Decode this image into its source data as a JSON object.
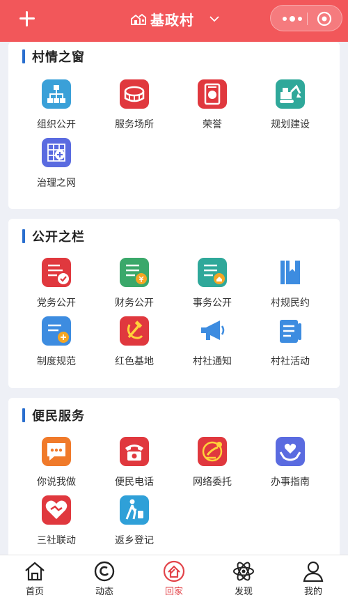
{
  "header": {
    "title": "基政村",
    "left_icon": "plus-icon",
    "title_icon": "village-icon",
    "dropdown_icon": "chevron-down-icon",
    "more_icon": "more-dots-icon",
    "close_icon": "target-icon",
    "bg_color": "#f2575a"
  },
  "sections": [
    {
      "title": "村情之窗",
      "items": [
        {
          "label": "组织公开",
          "icon": "org-chart-icon",
          "color": "#3aa0d8"
        },
        {
          "label": "服务场所",
          "icon": "stadium-icon",
          "color": "#e0383e"
        },
        {
          "label": "荣誉",
          "icon": "medal-icon",
          "color": "#e0383e"
        },
        {
          "label": "规划建设",
          "icon": "excavator-icon",
          "color": "#2fa89a"
        },
        {
          "label": "治理之网",
          "icon": "grid-shield-icon",
          "color": "#5a6be0"
        }
      ]
    },
    {
      "title": "公开之栏",
      "items": [
        {
          "label": "党务公开",
          "icon": "party-doc-icon",
          "color": "#e0383e"
        },
        {
          "label": "财务公开",
          "icon": "finance-doc-icon",
          "color": "#3aa86a"
        },
        {
          "label": "事务公开",
          "icon": "affairs-doc-icon",
          "color": "#2fa89a"
        },
        {
          "label": "村规民约",
          "icon": "bookmark-book-icon",
          "color": "#3d8ce0"
        },
        {
          "label": "制度规范",
          "icon": "rules-doc-icon",
          "color": "#3d8ce0"
        },
        {
          "label": "红色基地",
          "icon": "hammer-sickle-icon",
          "color": "#e0383e"
        },
        {
          "label": "村社通知",
          "icon": "megaphone-icon",
          "color": "#3d8ce0"
        },
        {
          "label": "村社活动",
          "icon": "activity-doc-icon",
          "color": "#3d8ce0"
        }
      ]
    },
    {
      "title": "便民服务",
      "items": [
        {
          "label": "你说我做",
          "icon": "chat-bubble-icon",
          "color": "#f07a2a"
        },
        {
          "label": "便民电话",
          "icon": "telephone-icon",
          "color": "#e0383e"
        },
        {
          "label": "网络委托",
          "icon": "delegate-icon",
          "color": "#e0383e"
        },
        {
          "label": "办事指南",
          "icon": "heart-hand-icon",
          "color": "#5a6be0"
        },
        {
          "label": "三社联动",
          "icon": "handshake-heart-icon",
          "color": "#e0383e"
        },
        {
          "label": "返乡登记",
          "icon": "traveler-icon",
          "color": "#2fa0d8"
        }
      ]
    }
  ],
  "tabbar": {
    "active_color": "#e2444a",
    "items": [
      {
        "label": "首页",
        "icon": "home-icon",
        "active": false
      },
      {
        "label": "动态",
        "icon": "dynamic-icon",
        "active": false
      },
      {
        "label": "回家",
        "icon": "return-home-icon",
        "active": true
      },
      {
        "label": "发现",
        "icon": "discover-atom-icon",
        "active": false
      },
      {
        "label": "我的",
        "icon": "profile-icon",
        "active": false
      }
    ]
  }
}
